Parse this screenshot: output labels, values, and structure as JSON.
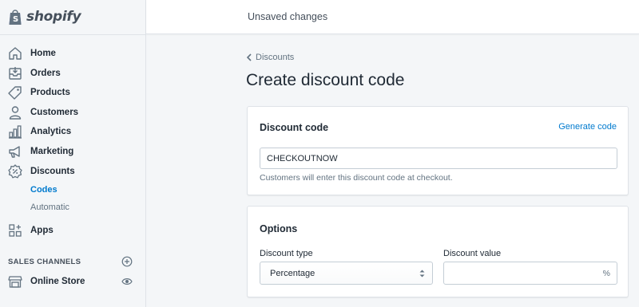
{
  "brand": {
    "name": "shopify"
  },
  "topbar": {
    "title": "Unsaved changes"
  },
  "sidebar": {
    "items": [
      {
        "label": "Home",
        "icon": "home-icon"
      },
      {
        "label": "Orders",
        "icon": "orders-inbox-icon"
      },
      {
        "label": "Products",
        "icon": "tag-icon"
      },
      {
        "label": "Customers",
        "icon": "person-icon"
      },
      {
        "label": "Analytics",
        "icon": "bar-chart-icon"
      },
      {
        "label": "Marketing",
        "icon": "megaphone-icon"
      },
      {
        "label": "Discounts",
        "icon": "discount-badge-icon"
      }
    ],
    "sub_items": [
      {
        "label": "Codes",
        "active": true
      },
      {
        "label": "Automatic",
        "active": false
      }
    ],
    "apps": {
      "label": "Apps",
      "icon": "apps-grid-icon"
    },
    "sales_channels": {
      "title": "SALES CHANNELS",
      "items": [
        {
          "label": "Online Store",
          "icon": "store-icon"
        }
      ]
    }
  },
  "main": {
    "breadcrumb": "Discounts",
    "title": "Create discount code",
    "code_card": {
      "title": "Discount code",
      "generate_label": "Generate code",
      "code_value": "CHECKOUTNOW",
      "help_text": "Customers will enter this discount code at checkout."
    },
    "options_card": {
      "title": "Options",
      "type_label": "Discount type",
      "type_value": "Percentage",
      "value_label": "Discount value",
      "value_suffix": "%"
    }
  },
  "colors": {
    "accent": "#007ace",
    "sidebar_bg": "#f4f6f8",
    "text": "#212b36",
    "muted": "#637381"
  }
}
